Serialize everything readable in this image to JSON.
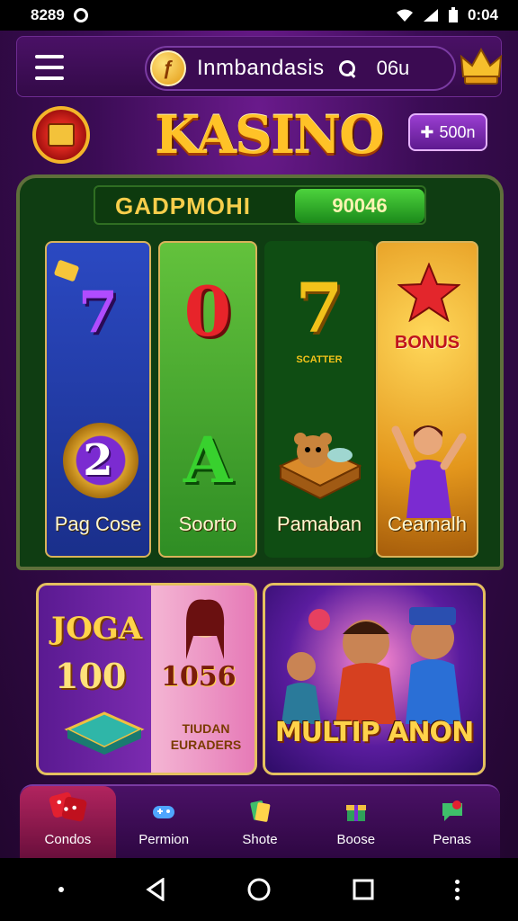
{
  "status_bar": {
    "time": "8289",
    "signal_text": "0:04"
  },
  "header": {
    "brand": "Inmbandasis",
    "search_code": "06u"
  },
  "hero": {
    "title": "KASINO",
    "coin_badge": "500n"
  },
  "panel": {
    "name": "GADPMOHI",
    "amount": "90046",
    "reels": [
      {
        "symbol_top": "7",
        "symbol_bottom": "2",
        "caption": "Pag Cose"
      },
      {
        "symbol_top": "0",
        "symbol_bottom": "A",
        "caption": "Soorto"
      },
      {
        "symbol_top": "7",
        "symbol_label": "SCATTER",
        "caption": "Pamaban"
      },
      {
        "symbol_label": "BONUS",
        "caption": "Ceamalh"
      }
    ]
  },
  "promos": [
    {
      "title": "JOGA",
      "value": "100",
      "value2": "1056",
      "sub": "TIUDAN EURADERS"
    },
    {
      "title": "MULTIP ANON"
    }
  ],
  "bottom_nav": [
    {
      "label": "Condos",
      "active": true,
      "icon": "dice-icon"
    },
    {
      "label": "Permion",
      "active": false,
      "icon": "gamepad-icon"
    },
    {
      "label": "Shote",
      "active": false,
      "icon": "cards-icon"
    },
    {
      "label": "Boose",
      "active": false,
      "icon": "gift-icon"
    },
    {
      "label": "Penas",
      "active": false,
      "icon": "chat-icon"
    }
  ],
  "colors": {
    "accent": "#ffc227",
    "panel_bg": "#0f3d12",
    "nav_active": "#b2245f"
  }
}
